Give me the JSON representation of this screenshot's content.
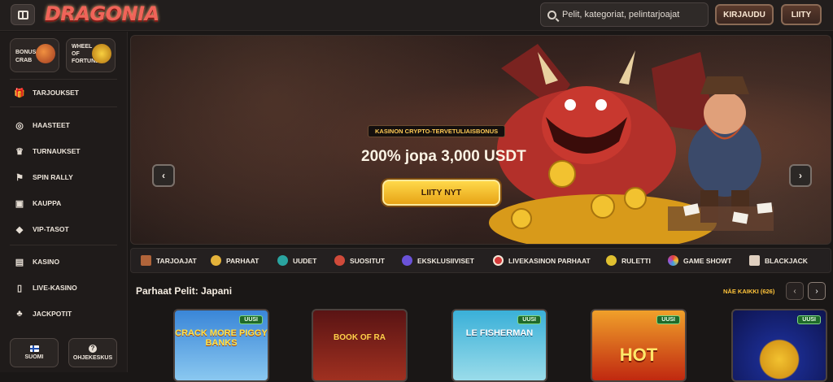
{
  "header": {
    "logo_text": "DRAGONIA",
    "search_placeholder": "Pelit, kategoriat, pelintarjoajat",
    "login_label": "KIRJAUDU",
    "join_label": "LIITY"
  },
  "sidebar": {
    "promos": [
      {
        "label": "BONUS CRAB",
        "lines": [
          "BONUS",
          "CRAB"
        ]
      },
      {
        "label": "WHEEL OF FORTUNE",
        "lines": [
          "WHEEL",
          "OF",
          "FORTUNE"
        ]
      }
    ],
    "items": [
      {
        "label": "TARJOUKSET",
        "icon": "gift-icon"
      },
      {
        "label": "HAASTEET",
        "icon": "medal-icon"
      },
      {
        "label": "TURNAUKSET",
        "icon": "trophy-icon"
      },
      {
        "label": "SPIN RALLY",
        "icon": "racing-icon"
      },
      {
        "label": "KAUPPA",
        "icon": "shop-bag-icon"
      },
      {
        "label": "VIP-TASOT",
        "icon": "diamond-icon"
      },
      {
        "label": "KASINO",
        "icon": "slot-machine-icon"
      },
      {
        "label": "LIVE-KASINO",
        "icon": "card-icon"
      },
      {
        "label": "JACKPOTIT",
        "icon": "clover-icon"
      }
    ],
    "language_label": "SUOMI",
    "help_label": "OHJEKESKUS"
  },
  "hero": {
    "badge": "KASINON CRYPTO-TERVETULIAISBONUS",
    "title": "200% jopa 3,000 USDT",
    "cta": "LIITY NYT",
    "slides": 4,
    "active_slide": 1
  },
  "categories": [
    {
      "label": "TARJOAJAT",
      "icon": "chest-icon",
      "color": "#b0643a"
    },
    {
      "label": "PARHAAT",
      "icon": "star-burst-icon",
      "color": "#e4b23a"
    },
    {
      "label": "UUDET",
      "icon": "gem-icon",
      "color": "#2aa4a0"
    },
    {
      "label": "SUOSITUT",
      "icon": "rocket-icon",
      "color": "#d04a3a"
    },
    {
      "label": "EKSKLUSIIVISET",
      "icon": "crystal-icon",
      "color": "#6a52d8"
    },
    {
      "label": "LIVEKASINON PARHAAT",
      "icon": "roulette-chip-icon",
      "color": "#d43a3a"
    },
    {
      "label": "RULETTI",
      "icon": "roulette-icon",
      "color": "#e0c030"
    },
    {
      "label": "GAME SHOWT",
      "icon": "wheel-icon",
      "color": "#c080e0"
    },
    {
      "label": "BLACKJACK",
      "icon": "cards-icon",
      "color": "#e0d0c0"
    }
  ],
  "games_section": {
    "title": "Parhaat Pelit: Japani",
    "see_all": "NÄE KAIKKI (626)",
    "games": [
      {
        "name": "CRACK MORE PIGGY BANKS",
        "badge": "UUSI",
        "bg": "#3a86d8"
      },
      {
        "name": "BOOK OF RA",
        "badge": "",
        "bg": "#5a1414"
      },
      {
        "name": "LE FISHERMAN",
        "badge": "UUSI",
        "bg": "#3ab0d8"
      },
      {
        "name": "HOT",
        "badge": "UUSI",
        "bg": "#e0641a"
      },
      {
        "name": "",
        "badge": "UUSI",
        "bg": "#1a2a8a"
      }
    ]
  }
}
